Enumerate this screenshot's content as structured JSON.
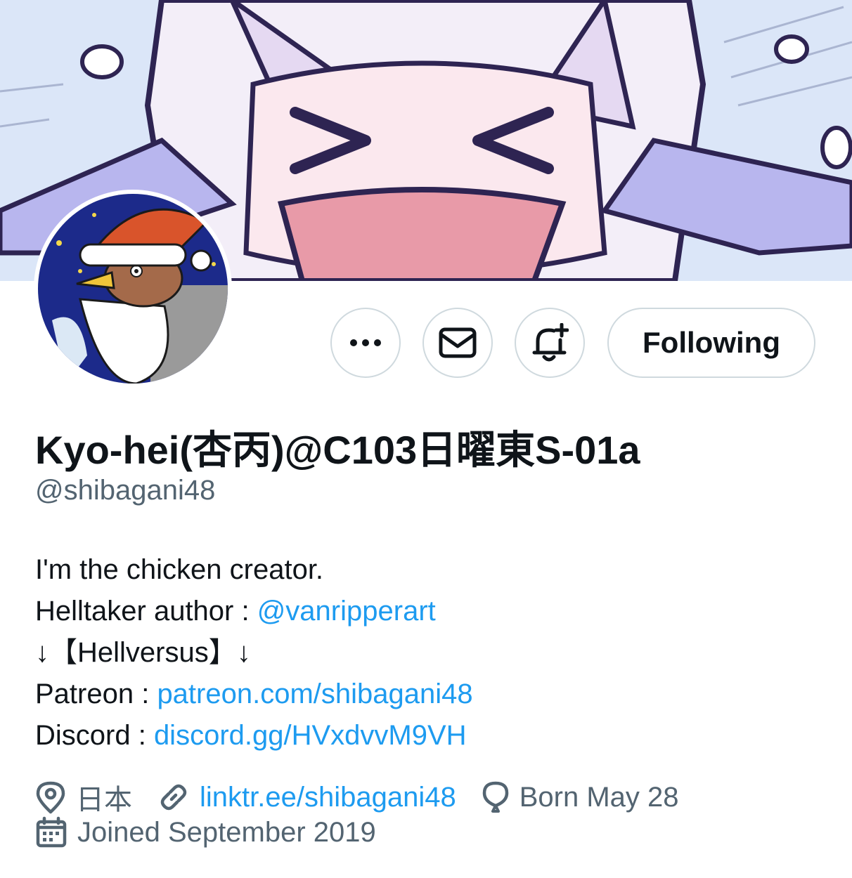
{
  "actions": {
    "more_label": "More",
    "message_label": "Message",
    "notify_label": "Turn on notifications",
    "follow_label": "Following"
  },
  "profile": {
    "display_name": "Kyo-hei(杏丙)@C103日曜東S-01a",
    "handle": "@shibagani48"
  },
  "bio": {
    "line1": "I'm the chicken creator.",
    "line2_prefix": "Helltaker author : ",
    "line2_link": "@vanripperart",
    "line3": "↓【Hellversus】↓",
    "line4_prefix": "Patreon : ",
    "line4_link": "patreon.com/shibagani48",
    "line5_prefix": "Discord : ",
    "line5_link": "discord.gg/HVxdvvM9VH"
  },
  "meta": {
    "location": "日本",
    "website": "linktr.ee/shibagani48",
    "birthday": "Born May 28",
    "joined": "Joined September 2019"
  },
  "icons": {
    "more": "more-dots-icon",
    "message": "envelope-icon",
    "notify": "bell-plus-icon",
    "location": "location-pin-icon",
    "website": "link-icon",
    "birthday": "balloon-icon",
    "joined": "calendar-icon"
  },
  "colors": {
    "link": "#1d9bf0",
    "secondary_text": "#536471",
    "border": "#cfd9de",
    "primary_text": "#0f1419"
  }
}
